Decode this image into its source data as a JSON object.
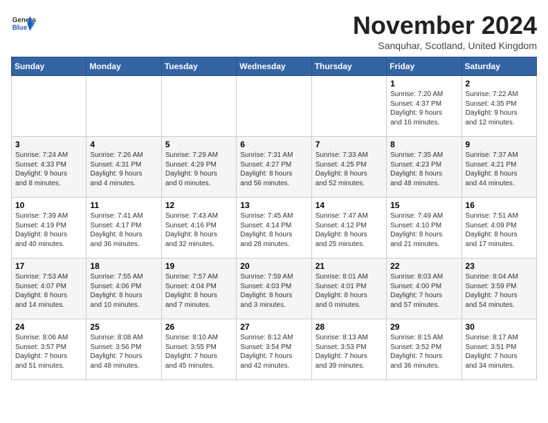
{
  "header": {
    "logo_line1": "General",
    "logo_line2": "Blue",
    "month_title": "November 2024",
    "subtitle": "Sanquhar, Scotland, United Kingdom"
  },
  "weekdays": [
    "Sunday",
    "Monday",
    "Tuesday",
    "Wednesday",
    "Thursday",
    "Friday",
    "Saturday"
  ],
  "weeks": [
    [
      {
        "day": "",
        "info": ""
      },
      {
        "day": "",
        "info": ""
      },
      {
        "day": "",
        "info": ""
      },
      {
        "day": "",
        "info": ""
      },
      {
        "day": "",
        "info": ""
      },
      {
        "day": "1",
        "info": "Sunrise: 7:20 AM\nSunset: 4:37 PM\nDaylight: 9 hours\nand 16 minutes."
      },
      {
        "day": "2",
        "info": "Sunrise: 7:22 AM\nSunset: 4:35 PM\nDaylight: 9 hours\nand 12 minutes."
      }
    ],
    [
      {
        "day": "3",
        "info": "Sunrise: 7:24 AM\nSunset: 4:33 PM\nDaylight: 9 hours\nand 8 minutes."
      },
      {
        "day": "4",
        "info": "Sunrise: 7:26 AM\nSunset: 4:31 PM\nDaylight: 9 hours\nand 4 minutes."
      },
      {
        "day": "5",
        "info": "Sunrise: 7:29 AM\nSunset: 4:29 PM\nDaylight: 9 hours\nand 0 minutes."
      },
      {
        "day": "6",
        "info": "Sunrise: 7:31 AM\nSunset: 4:27 PM\nDaylight: 8 hours\nand 56 minutes."
      },
      {
        "day": "7",
        "info": "Sunrise: 7:33 AM\nSunset: 4:25 PM\nDaylight: 8 hours\nand 52 minutes."
      },
      {
        "day": "8",
        "info": "Sunrise: 7:35 AM\nSunset: 4:23 PM\nDaylight: 8 hours\nand 48 minutes."
      },
      {
        "day": "9",
        "info": "Sunrise: 7:37 AM\nSunset: 4:21 PM\nDaylight: 8 hours\nand 44 minutes."
      }
    ],
    [
      {
        "day": "10",
        "info": "Sunrise: 7:39 AM\nSunset: 4:19 PM\nDaylight: 8 hours\nand 40 minutes."
      },
      {
        "day": "11",
        "info": "Sunrise: 7:41 AM\nSunset: 4:17 PM\nDaylight: 8 hours\nand 36 minutes."
      },
      {
        "day": "12",
        "info": "Sunrise: 7:43 AM\nSunset: 4:16 PM\nDaylight: 8 hours\nand 32 minutes."
      },
      {
        "day": "13",
        "info": "Sunrise: 7:45 AM\nSunset: 4:14 PM\nDaylight: 8 hours\nand 28 minutes."
      },
      {
        "day": "14",
        "info": "Sunrise: 7:47 AM\nSunset: 4:12 PM\nDaylight: 8 hours\nand 25 minutes."
      },
      {
        "day": "15",
        "info": "Sunrise: 7:49 AM\nSunset: 4:10 PM\nDaylight: 8 hours\nand 21 minutes."
      },
      {
        "day": "16",
        "info": "Sunrise: 7:51 AM\nSunset: 4:09 PM\nDaylight: 8 hours\nand 17 minutes."
      }
    ],
    [
      {
        "day": "17",
        "info": "Sunrise: 7:53 AM\nSunset: 4:07 PM\nDaylight: 8 hours\nand 14 minutes."
      },
      {
        "day": "18",
        "info": "Sunrise: 7:55 AM\nSunset: 4:06 PM\nDaylight: 8 hours\nand 10 minutes."
      },
      {
        "day": "19",
        "info": "Sunrise: 7:57 AM\nSunset: 4:04 PM\nDaylight: 8 hours\nand 7 minutes."
      },
      {
        "day": "20",
        "info": "Sunrise: 7:59 AM\nSunset: 4:03 PM\nDaylight: 8 hours\nand 3 minutes."
      },
      {
        "day": "21",
        "info": "Sunrise: 8:01 AM\nSunset: 4:01 PM\nDaylight: 8 hours\nand 0 minutes."
      },
      {
        "day": "22",
        "info": "Sunrise: 8:03 AM\nSunset: 4:00 PM\nDaylight: 7 hours\nand 57 minutes."
      },
      {
        "day": "23",
        "info": "Sunrise: 8:04 AM\nSunset: 3:59 PM\nDaylight: 7 hours\nand 54 minutes."
      }
    ],
    [
      {
        "day": "24",
        "info": "Sunrise: 8:06 AM\nSunset: 3:57 PM\nDaylight: 7 hours\nand 51 minutes."
      },
      {
        "day": "25",
        "info": "Sunrise: 8:08 AM\nSunset: 3:56 PM\nDaylight: 7 hours\nand 48 minutes."
      },
      {
        "day": "26",
        "info": "Sunrise: 8:10 AM\nSunset: 3:55 PM\nDaylight: 7 hours\nand 45 minutes."
      },
      {
        "day": "27",
        "info": "Sunrise: 8:12 AM\nSunset: 3:54 PM\nDaylight: 7 hours\nand 42 minutes."
      },
      {
        "day": "28",
        "info": "Sunrise: 8:13 AM\nSunset: 3:53 PM\nDaylight: 7 hours\nand 39 minutes."
      },
      {
        "day": "29",
        "info": "Sunrise: 8:15 AM\nSunset: 3:52 PM\nDaylight: 7 hours\nand 36 minutes."
      },
      {
        "day": "30",
        "info": "Sunrise: 8:17 AM\nSunset: 3:51 PM\nDaylight: 7 hours\nand 34 minutes."
      }
    ]
  ]
}
